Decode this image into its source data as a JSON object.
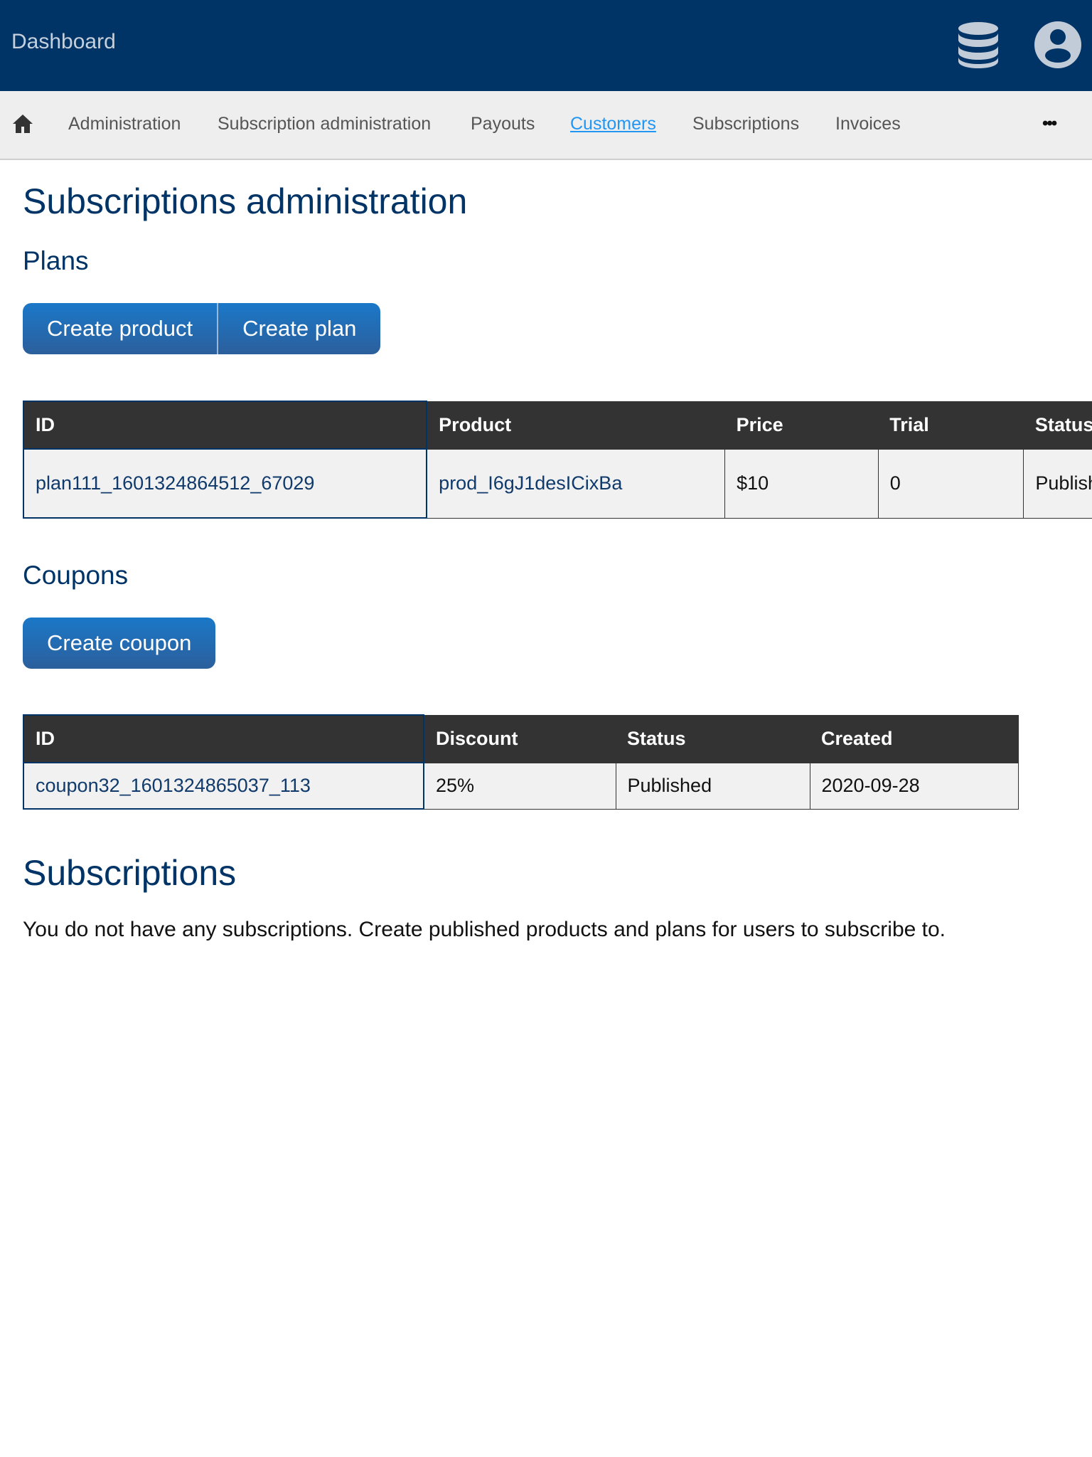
{
  "header": {
    "title": "Dashboard",
    "icons": [
      "database-icon",
      "user-icon"
    ]
  },
  "nav": {
    "items": [
      {
        "label": "Administration",
        "active": false
      },
      {
        "label": "Subscription administration",
        "active": false
      },
      {
        "label": "Payouts",
        "active": false
      },
      {
        "label": "Customers",
        "active": true
      },
      {
        "label": "Subscriptions",
        "active": false
      },
      {
        "label": "Invoices",
        "active": false
      }
    ],
    "more": "•••"
  },
  "page": {
    "title": "Subscriptions administration"
  },
  "plans": {
    "heading": "Plans",
    "buttons": [
      "Create product",
      "Create plan"
    ],
    "columns": [
      "ID",
      "Product",
      "Price",
      "Trial",
      "Status"
    ],
    "rows": [
      [
        "plan111_1601324864512_67029",
        "prod_I6gJ1desICixBa",
        "$10",
        "0",
        "Published"
      ]
    ]
  },
  "coupons": {
    "heading": "Coupons",
    "button": "Create coupon",
    "columns": [
      "ID",
      "Discount",
      "Status",
      "Created"
    ],
    "rows": [
      [
        "coupon32_1601324865037_113",
        "25%",
        "Published",
        "2020-09-28"
      ]
    ]
  },
  "subscriptions": {
    "heading": "Subscriptions",
    "empty_message": "You do not have any subscriptions. Create published products and plans for users to subscribe to."
  }
}
